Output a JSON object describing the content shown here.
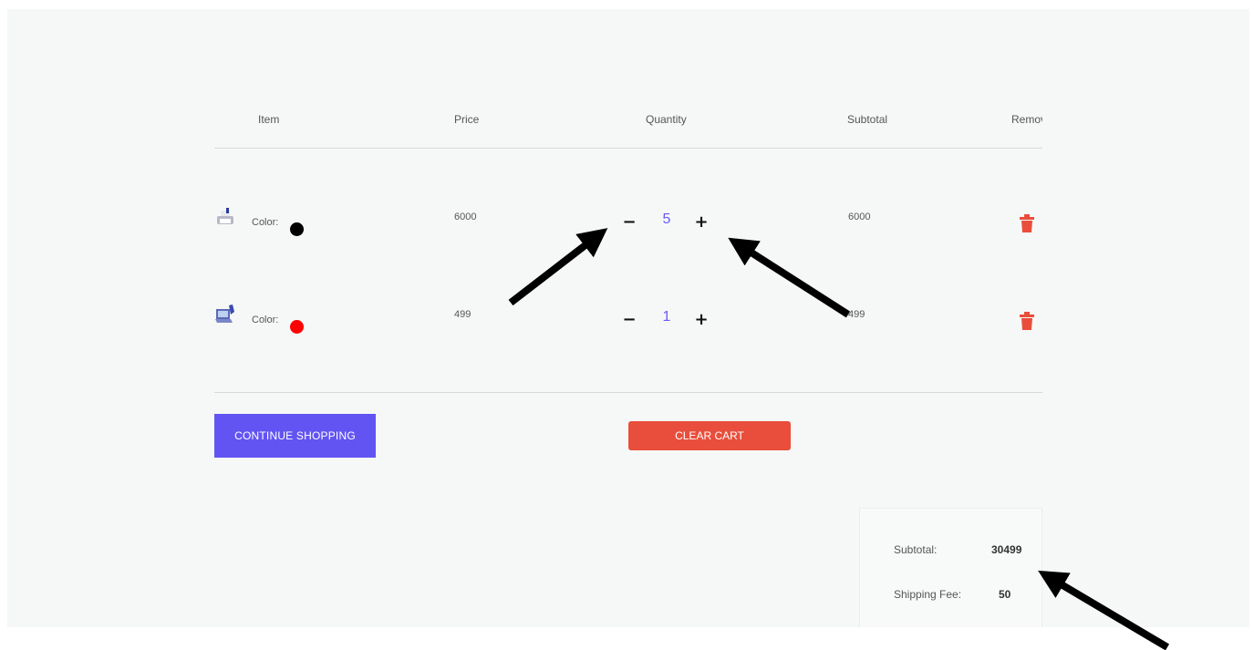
{
  "table_headers": {
    "item": "Item",
    "price": "Price",
    "quantity": "Quantity",
    "subtotal": "Subtotal",
    "remove": "Remove"
  },
  "items": [
    {
      "color_label": "Color:",
      "color": "#000000",
      "price": "6000",
      "quantity": "5",
      "subtotal": "6000",
      "thumbnail_icon": "printer-icon"
    },
    {
      "color_label": "Color:",
      "color": "#ff0000",
      "price": "499",
      "quantity": "1",
      "subtotal": "499",
      "thumbnail_icon": "laptop-icon"
    }
  ],
  "qty_controls": {
    "minus": "−",
    "plus": "+"
  },
  "buttons": {
    "continue_shopping": "CONTINUE SHOPPING",
    "clear_cart": "CLEAR CART"
  },
  "summary": {
    "subtotal_label": "Subtotal:",
    "subtotal_value": "30499",
    "shipping_label": "Shipping Fee:",
    "shipping_value": "50"
  },
  "colors": {
    "accent": "#6254f3",
    "danger": "#e94e3c",
    "quantity_text": "#6a5af9",
    "annotation_arrow": "#000000"
  }
}
